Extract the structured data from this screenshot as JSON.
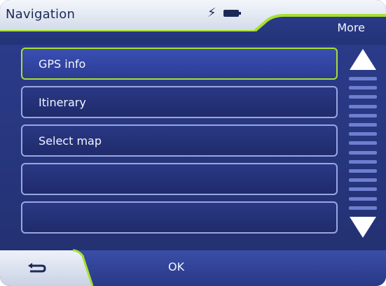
{
  "header": {
    "title": "Navigation",
    "more_label": "More",
    "status_icons": [
      "lightning-icon",
      "battery-icon"
    ]
  },
  "menu": {
    "items": [
      {
        "label": "GPS info",
        "selected": true
      },
      {
        "label": "Itinerary",
        "selected": false
      },
      {
        "label": "Select map",
        "selected": false
      },
      {
        "label": "",
        "selected": false
      },
      {
        "label": "",
        "selected": false
      }
    ]
  },
  "scrollbar": {
    "up_icon": "up-arrow-icon",
    "down_icon": "down-arrow-icon"
  },
  "footer": {
    "back_icon": "back-arrow-icon",
    "ok_label": "OK"
  },
  "colors": {
    "background": "#22306f",
    "header_light": "#e8edf6",
    "accent_green": "#a8e02e",
    "row_border": "#9aa6e2",
    "text": "#f4f6ff"
  }
}
